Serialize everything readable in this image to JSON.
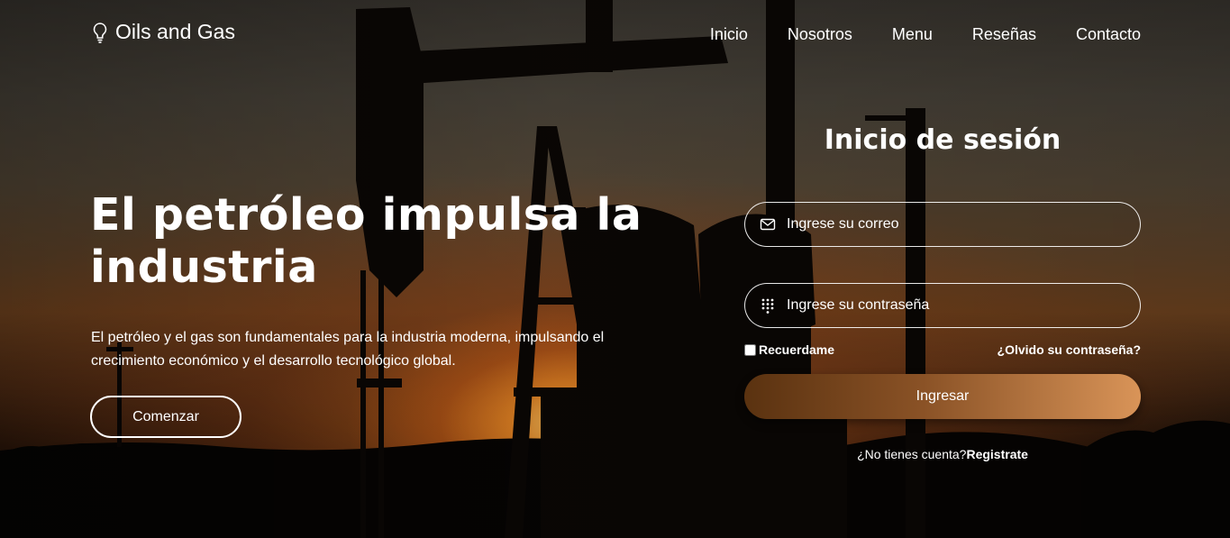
{
  "header": {
    "logo_text": "Oils and Gas",
    "logo_icon": "lightbulb-icon",
    "nav": [
      {
        "label": "Inicio"
      },
      {
        "label": "Nosotros"
      },
      {
        "label": "Menu"
      },
      {
        "label": "Reseñas"
      },
      {
        "label": "Contacto"
      }
    ]
  },
  "hero": {
    "title": "El petróleo impulsa la industria",
    "description": "El petróleo y el gas son fundamentales para la industria moderna, impulsando el crecimiento económico y el desarrollo tecnológico global.",
    "cta_label": "Comenzar"
  },
  "login": {
    "title": "Inicio de sesión",
    "email_placeholder": "Ingrese su correo",
    "email_icon": "envelope-icon",
    "password_placeholder": "Ingrese su contraseña",
    "password_icon": "keypad-icon",
    "remember_label": "Recuerdame",
    "forgot_label": "¿Olvido su contraseña?",
    "submit_label": "Ingresar",
    "signup_prompt": "¿No tienes cuenta?",
    "signup_link": "Registrate"
  },
  "colors": {
    "button_gradient_start": "#5a3210",
    "button_gradient_end": "#d99458",
    "text": "#ffffff"
  }
}
